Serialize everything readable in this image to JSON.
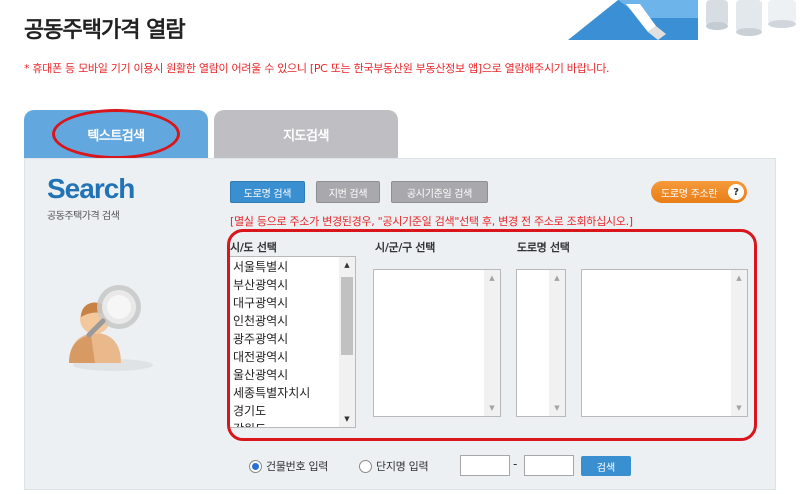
{
  "page": {
    "title": "공동주택가격 열람",
    "notice": "* 휴대폰 등 모바일 기기 이용시 원활한 열람이 어려울 수 있으니 [PC 또는 한국부동산원 부동산정보 앱]으로 열람해주시기 바랍니다."
  },
  "tabs": [
    {
      "label": "텍스트검색",
      "active": true
    },
    {
      "label": "지도검색",
      "active": false
    }
  ],
  "logo": {
    "title": "Search",
    "subtitle": "공동주택가격 검색"
  },
  "search_modes": [
    {
      "label": "도로명 검색",
      "active": true
    },
    {
      "label": "지번 검색",
      "active": false
    },
    {
      "label": "공시기준일 검색",
      "active": false
    }
  ],
  "road_guide": {
    "label": "도로명 주소란",
    "help": "?"
  },
  "hint": "[멸실 등으로 주소가 변경된경우, \"공시기준일 검색\"선택 후, 변경 전 주소로 조회하십시오.]",
  "columns": {
    "sido": "시/도 선택",
    "sigungu": "시/군/구 선택",
    "road": "도로명 선택"
  },
  "sido_options": [
    "서울특별시",
    "부산광역시",
    "대구광역시",
    "인천광역시",
    "광주광역시",
    "대전광역시",
    "울산광역시",
    "세종특별자치시",
    "경기도",
    "강원도"
  ],
  "bottom": {
    "building_radio": "건물번호 입력",
    "complex_radio": "단지명 입력",
    "dash": "-",
    "search_button": "검색"
  },
  "colors": {
    "active_tab": "#62a8de",
    "inactive_tab": "#bfbfc3",
    "highlight_ring": "#d9161b",
    "notice_text": "#e8262a",
    "primary_button": "#3a8fd0",
    "guide_button": "#ef8a26"
  }
}
